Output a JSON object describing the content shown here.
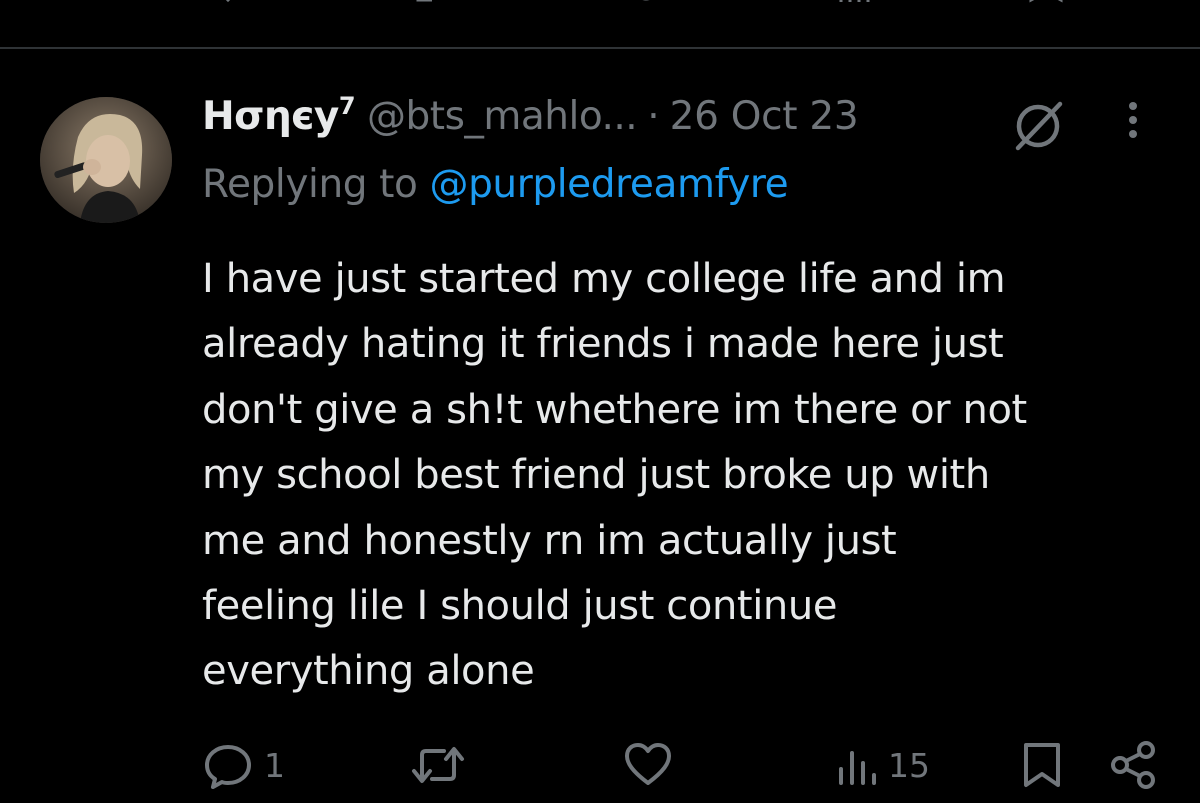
{
  "tweet": {
    "display_name": "Hσηєу",
    "display_name_sup": "7",
    "handle": "@bts_mahlo...",
    "separator": "·",
    "date": "26 Oct 23",
    "reply_prefix": "Replying to ",
    "reply_mention": "@purpledreamfyre",
    "text_lines": [
      "I have just started my college life and im",
      "already hating it friends i made here just",
      "don't give a sh!t whethere im there or not",
      "my school best friend just broke up with",
      "me and honestly rn im actually just",
      "feeling lile I should just continue",
      "everything alone"
    ],
    "actions": {
      "reply": {
        "icon": "reply-icon",
        "count": "1"
      },
      "retweet": {
        "icon": "retweet-icon",
        "count": ""
      },
      "like": {
        "icon": "heart-icon",
        "count": ""
      },
      "views": {
        "icon": "views-icon",
        "count": "15"
      },
      "bookmark": {
        "icon": "bookmark-icon"
      },
      "share": {
        "icon": "share-icon"
      }
    }
  },
  "colors": {
    "background": "#000000",
    "text": "#e7e9ea",
    "secondary": "#71767b",
    "link": "#1d9bf0",
    "divider": "#2f3336"
  }
}
